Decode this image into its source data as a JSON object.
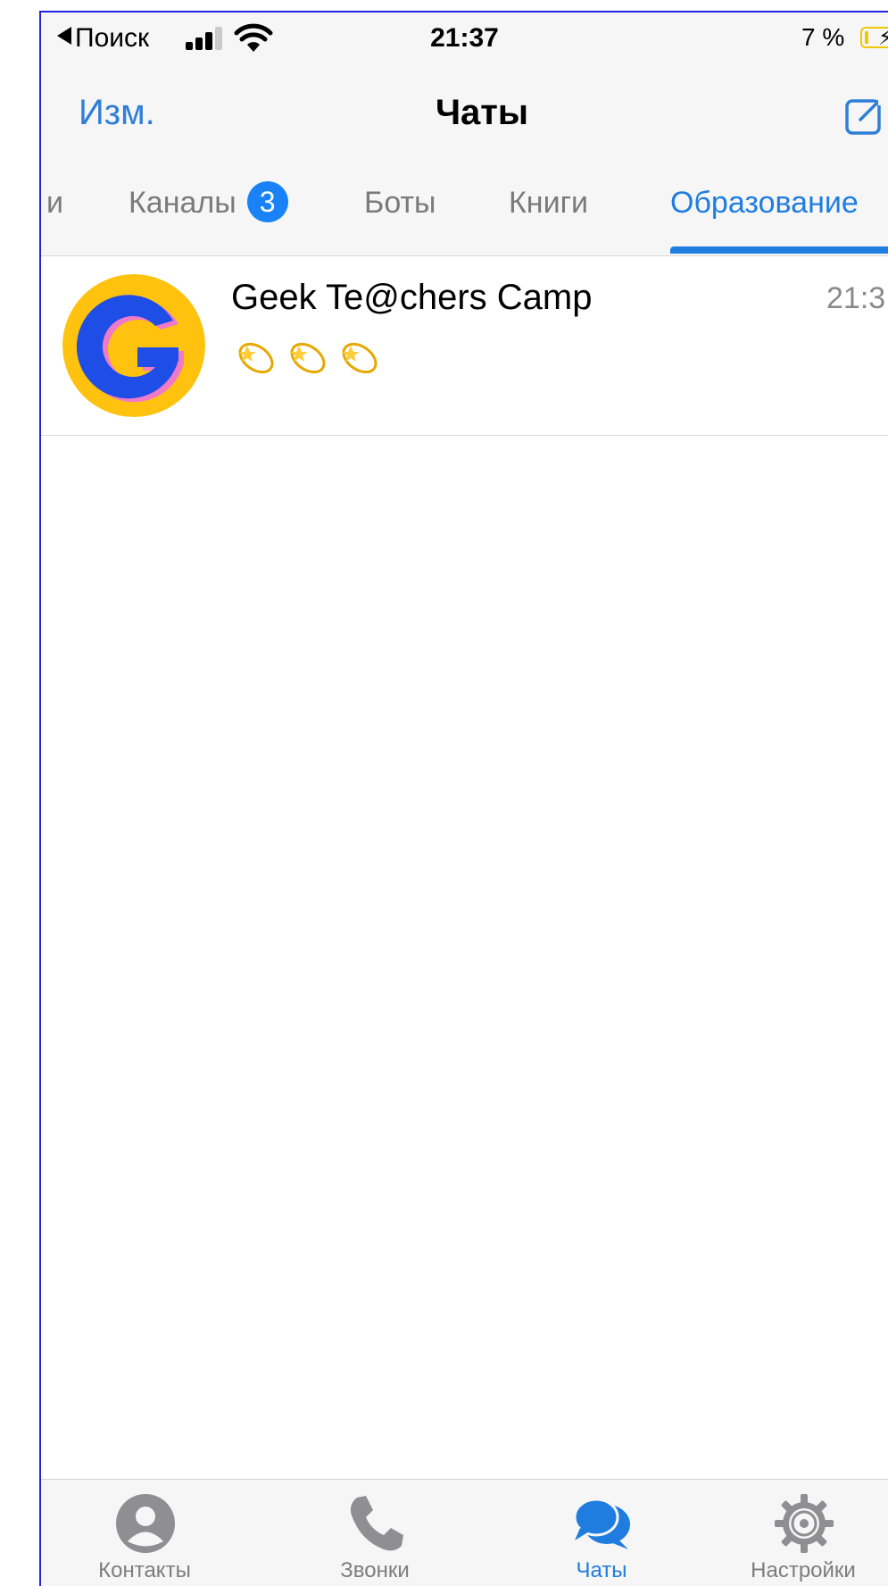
{
  "status_bar": {
    "back_label": "Поиск",
    "time": "21:37",
    "battery_percent": "7 %"
  },
  "nav": {
    "edit_label": "Изм.",
    "title": "Чаты"
  },
  "folder_tabs": [
    {
      "label": "и"
    },
    {
      "label": "Каналы",
      "badge": "3"
    },
    {
      "label": "Боты"
    },
    {
      "label": "Книги"
    },
    {
      "label": "Образование",
      "active": true
    }
  ],
  "chats": [
    {
      "name": "Geek Te@chers Camp",
      "time": "21:3",
      "preview_icon": "dizzy-star-emoji",
      "preview_count": 3
    }
  ],
  "tab_bar": {
    "items": [
      {
        "label": "Контакты",
        "icon": "person-circle-icon"
      },
      {
        "label": "Звонки",
        "icon": "phone-icon"
      },
      {
        "label": "Чаты",
        "icon": "chat-bubbles-icon",
        "active": true
      },
      {
        "label": "Настройки",
        "icon": "gear-icon"
      }
    ]
  },
  "colors": {
    "accent": "#1f7de0",
    "badge": "#1a82f7",
    "avatar_yellow": "#ffc20e",
    "avatar_blue": "#1f4ee6",
    "avatar_pink": "#f07ac8"
  }
}
